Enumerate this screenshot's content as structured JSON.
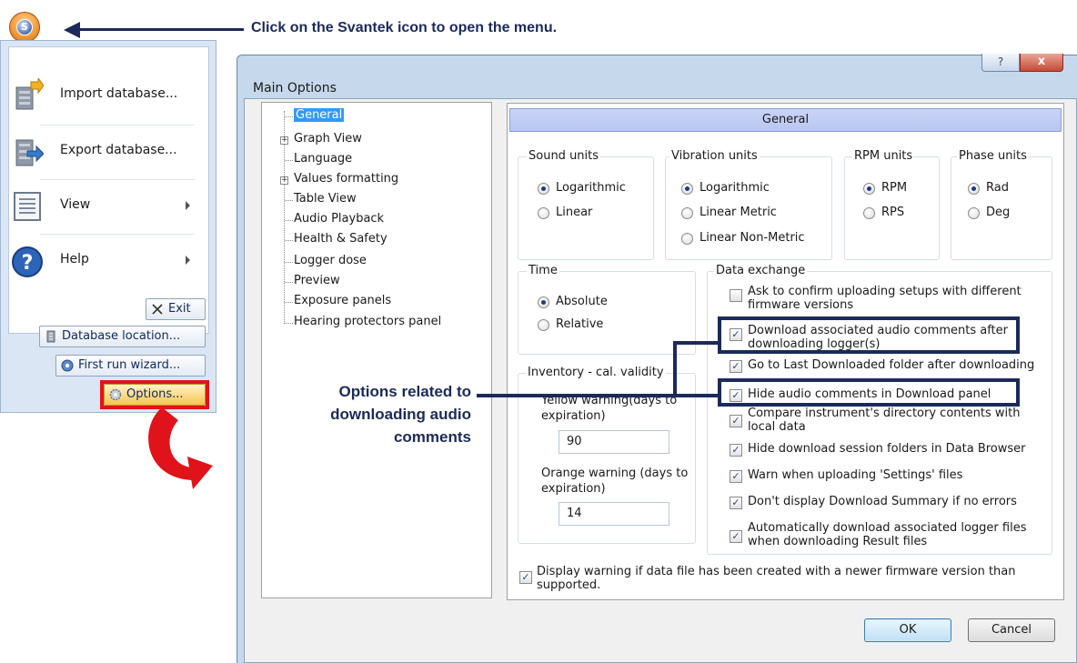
{
  "annotations": {
    "top_instruction": "Click on the Svantek icon to open the menu.",
    "side_note": "Options related to downloading audio comments"
  },
  "app_menu": {
    "items": [
      {
        "label": "Import database...",
        "icon": "import-database-icon"
      },
      {
        "label": "Export database...",
        "icon": "export-database-icon"
      },
      {
        "label": "View",
        "icon": "view-icon"
      },
      {
        "label": "Help",
        "icon": "help-icon"
      }
    ],
    "footer_buttons": {
      "exit": "Exit",
      "database_location": "Database location...",
      "first_run_wizard": "First run wizard...",
      "options": "Options..."
    }
  },
  "dialog": {
    "title": "Main Options",
    "help_glyph": "?",
    "close_glyph": "x",
    "tree": [
      {
        "label": "General",
        "selected": true,
        "expandable": false
      },
      {
        "label": "Graph View",
        "expandable": true
      },
      {
        "label": "Language",
        "expandable": false
      },
      {
        "label": "Values formatting",
        "expandable": true
      },
      {
        "label": "Table View",
        "expandable": false
      },
      {
        "label": "Audio Playback",
        "expandable": false
      },
      {
        "label": "Health & Safety",
        "expandable": false
      },
      {
        "label": "Logger dose",
        "expandable": false
      },
      {
        "label": "Preview",
        "expandable": false
      },
      {
        "label": "Exposure panels",
        "expandable": false
      },
      {
        "label": "Hearing protectors panel",
        "expandable": false
      }
    ],
    "panel_header": "General",
    "sound_units": {
      "label": "Sound units",
      "options": [
        "Logarithmic",
        "Linear"
      ],
      "selected": "Logarithmic"
    },
    "vibration_units": {
      "label": "Vibration units",
      "options": [
        "Logarithmic",
        "Linear Metric",
        "Linear Non-Metric"
      ],
      "selected": "Logarithmic"
    },
    "rpm_units": {
      "label": "RPM units",
      "options": [
        "RPM",
        "RPS"
      ],
      "selected": "RPM"
    },
    "phase_units": {
      "label": "Phase units",
      "options": [
        "Rad",
        "Deg"
      ],
      "selected": "Rad"
    },
    "time": {
      "label": "Time",
      "options": [
        "Absolute",
        "Relative"
      ],
      "selected": "Absolute"
    },
    "inventory": {
      "label": "Inventory - cal. validity",
      "yellow_label": "Yellow warning(days to expiration)",
      "yellow_value": "90",
      "orange_label": "Orange warning (days to expiration)",
      "orange_value": "14"
    },
    "data_exchange": {
      "label": "Data exchange",
      "options": [
        {
          "label": "Ask to confirm uploading setups with different firmware versions",
          "checked": false
        },
        {
          "label": "Download associated audio comments after downloading logger(s)",
          "checked": true
        },
        {
          "label": "Go to Last Downloaded folder after downloading",
          "checked": true
        },
        {
          "label": "Hide audio comments in Download panel",
          "checked": true
        },
        {
          "label": "Compare instrument's directory contents with local data",
          "checked": true
        },
        {
          "label": "Hide download session folders in Data Browser",
          "checked": true
        },
        {
          "label": "Warn when uploading 'Settings' files",
          "checked": true
        },
        {
          "label": "Don't display Download Summary if no errors",
          "checked": true
        },
        {
          "label": "Automatically download associated logger files when downloading Result files",
          "checked": true
        }
      ]
    },
    "firmware_warning": {
      "label": "Display warning if data file has been created with a newer firmware version than supported.",
      "checked": true
    },
    "buttons": {
      "ok": "OK",
      "cancel": "Cancel"
    }
  },
  "check_glyph": "✓"
}
